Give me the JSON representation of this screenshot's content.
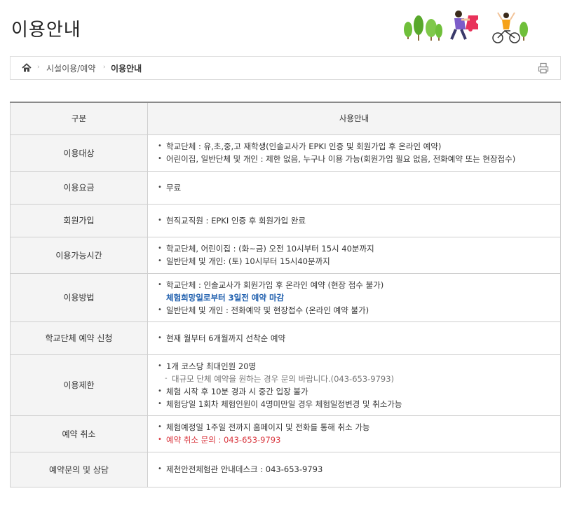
{
  "page": {
    "title": "이용안내"
  },
  "breadcrumb": {
    "home_icon": "home-icon",
    "items": [
      "시설이용/예약",
      "이용안내"
    ],
    "separator": "›",
    "print_icon": "print-icon"
  },
  "table": {
    "headers": [
      "구분",
      "사용안내"
    ],
    "rows": [
      {
        "label": "이용대상",
        "lines": [
          {
            "text": "학교단체 : 유,초,중,고 재학생(인솔교사가 EPKI 인증 및 회원가입 후 온라인 예약)",
            "style": "bullet"
          },
          {
            "text": "어린이집, 일반단체 및 개인 : 제한 없음, 누구나 이용 가능(회원가입 필요 없음, 전화예약 또는 현장접수)",
            "style": "bullet"
          }
        ]
      },
      {
        "label": "이용요금",
        "lines": [
          {
            "text": "무료",
            "style": "bullet"
          }
        ]
      },
      {
        "label": "회원가입",
        "lines": [
          {
            "text": "현직교직원 : EPKI 인증 후 회원가입 완료",
            "style": "bullet"
          }
        ]
      },
      {
        "label": "이용가능시간",
        "lines": [
          {
            "text": "학교단체, 어린이집 : (화~금) 오전 10시부터 15시 40분까지",
            "style": "bullet"
          },
          {
            "text": "일반단체 및 개인: (토) 10시부터 15시40분까지",
            "style": "bullet"
          }
        ]
      },
      {
        "label": "이용방법",
        "lines": [
          {
            "text": "학교단체 : 인솔교사가 회원가입 후 온라인 예약 (현장 접수 불가)",
            "style": "bullet"
          },
          {
            "text": "체험희망일로부터 3일전 예약 마감",
            "style": "blue"
          },
          {
            "text": "일반단체 및 개인 : 전화예약 및 현장접수 (온라인 예약 불가)",
            "style": "bullet"
          }
        ]
      },
      {
        "label": "학교단체 예약 신청",
        "lines": [
          {
            "text": "현재 월부터 6개월까지 선착순 예약",
            "style": "bullet"
          }
        ]
      },
      {
        "label": "이용제한",
        "lines": [
          {
            "text": "1개 코스당 최대인원 20명",
            "style": "bullet"
          },
          {
            "text": "대규모 단체 예약을 원하는 경우 문의 바랍니다.(043-653-9793)",
            "style": "sub"
          },
          {
            "text": "체험 시작 후 10분 경과 시 중간 입장 불가",
            "style": "bullet"
          },
          {
            "text": "체험당일 1회차 체험인원이 4명미만일 경우 체험일정변경 및 취소가능",
            "style": "bullet"
          }
        ]
      },
      {
        "label": "예약 취소",
        "lines": [
          {
            "text": "체험예정일 1주일 전까지 홈페이지 및 전화를 통해 취소 가능",
            "style": "bullet"
          },
          {
            "text": "예약 취소 문의 : 043-653-9793",
            "style": "red"
          }
        ]
      },
      {
        "label": "예약문의 및 상담",
        "lines": [
          {
            "text": "제천안전체험관 안내데스크 : 043-653-9793",
            "style": "bullet"
          }
        ]
      }
    ]
  },
  "colors": {
    "highlight_blue": "#1f5fae",
    "highlight_red": "#d9363e",
    "header_bg": "#f4f4f4"
  }
}
